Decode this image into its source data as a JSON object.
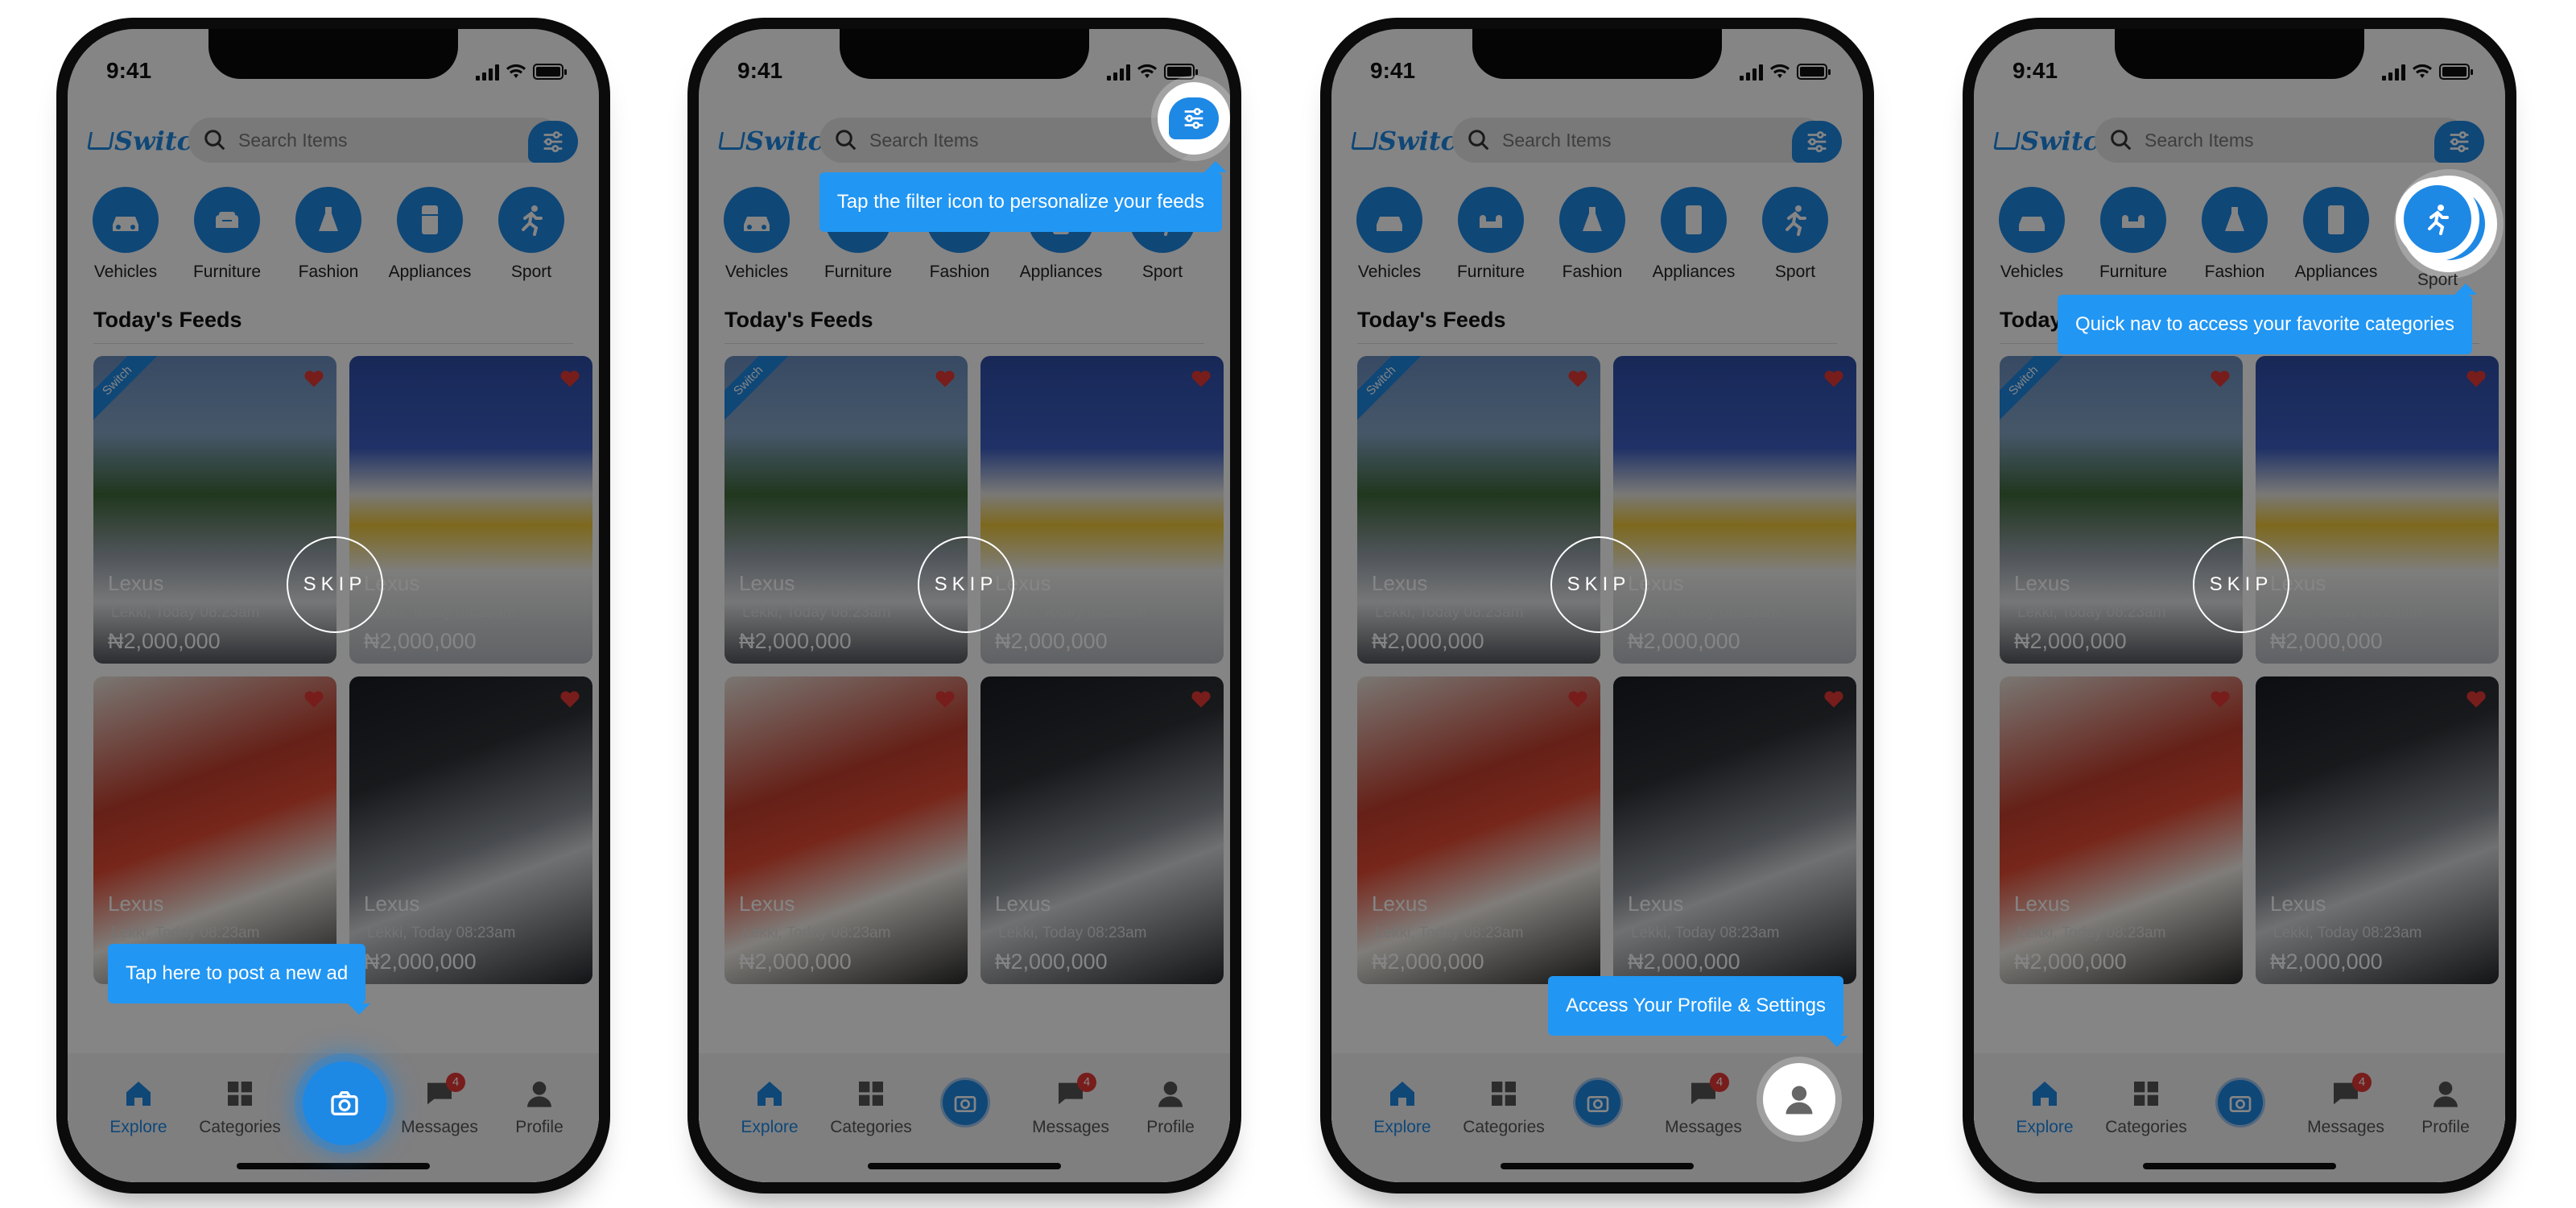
{
  "status": {
    "time": "9:41"
  },
  "app": {
    "brand": "Switch",
    "search_placeholder": "Search Items"
  },
  "categories": [
    {
      "label": "Vehicles",
      "icon": "car-icon"
    },
    {
      "label": "Furniture",
      "icon": "sofa-icon"
    },
    {
      "label": "Fashion",
      "icon": "dress-icon"
    },
    {
      "label": "Appliances",
      "icon": "fridge-icon"
    },
    {
      "label": "Sport",
      "icon": "running-icon"
    }
  ],
  "feeds_title": "Today's Feeds",
  "ribbon": "Switch",
  "cards": [
    {
      "title": "Lexus",
      "location": "Lekki, Today 08:23am",
      "price": "₦2,000,000"
    },
    {
      "title": "Lexus",
      "location": "Lekki, Today 08:23am",
      "price": "₦2,000,000"
    },
    {
      "title": "Lexus",
      "location": "Lekki, Today 08:23am",
      "price": "₦2,000,000"
    },
    {
      "title": "Lexus",
      "location": "Lekki, Today 08:23am",
      "price": "₦2,000,000"
    }
  ],
  "tabs": {
    "explore": "Explore",
    "categories": "Categories",
    "messages": "Messages",
    "profile": "Profile",
    "messages_badge": "4"
  },
  "skip_label": "SKIP",
  "tooltips": {
    "post_ad": "Tap here to post a new ad",
    "filter": "Tap the filter icon to personalize your feeds",
    "profile": "Access Your Profile & Settings",
    "quick_nav": "Quick nav to access your favorite categories"
  },
  "colors": {
    "accent": "#1e88e5",
    "tooltip": "#2196f3",
    "badge": "#e53935"
  }
}
